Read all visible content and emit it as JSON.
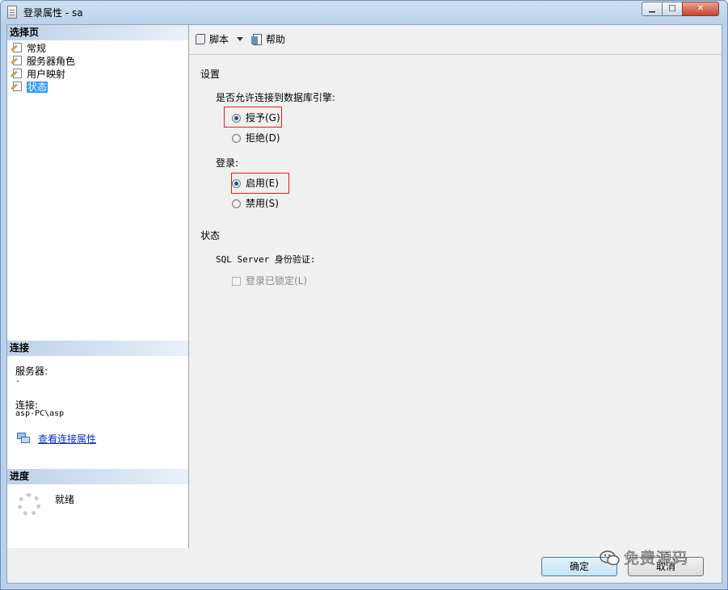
{
  "window": {
    "title": "登录属性 - sa",
    "min_label": "▁",
    "max_label": "□",
    "close_label": "✕"
  },
  "select_page": {
    "header": "选择页",
    "items": [
      {
        "label": "常规"
      },
      {
        "label": "服务器角色"
      },
      {
        "label": "用户映射"
      },
      {
        "label": "状态",
        "selected": true
      }
    ]
  },
  "connection": {
    "header": "连接",
    "server_label": "服务器:",
    "server_value": ".",
    "connection_label": "连接:",
    "connection_value": "asp-PC\\asp",
    "view_link": "查看连接属性"
  },
  "progress": {
    "header": "进度",
    "status": "就绪"
  },
  "toolbar": {
    "script_label": "脚本",
    "help_label": "帮助"
  },
  "settings": {
    "header": "设置",
    "connect_question": "是否允许连接到数据库引擎:",
    "grant_label": "授予(G)",
    "deny_label": "拒绝(D)",
    "connect_value": "grant",
    "login_label": "登录:",
    "enable_label": "启用(E)",
    "disable_label": "禁用(S)",
    "login_value": "enable"
  },
  "status": {
    "header": "状态",
    "auth_label": "SQL Server 身份验证:",
    "locked_label": "登录已锁定(L)",
    "locked_checked": false
  },
  "buttons": {
    "ok": "确定",
    "cancel": "取消"
  },
  "watermark": "免费源码",
  "colors": {
    "selection": "#3399ff",
    "highlight_box": "#e02020",
    "link": "#0033cc"
  }
}
